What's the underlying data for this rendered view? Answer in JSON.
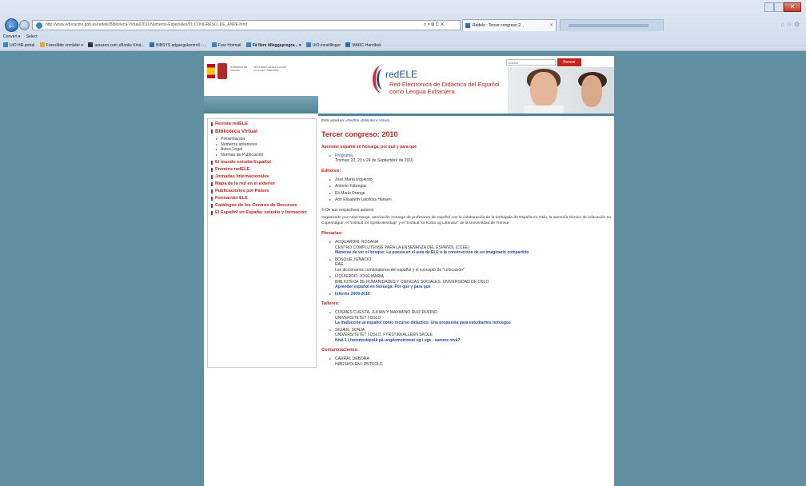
{
  "browser": {
    "address_url": "http://www.educacion.gob.es/redele/Biblioteca-Virtual/2011/Numeros-Especiales/III_CONGRESO_DE_ANPE.html",
    "address_tools": "⌕ ▾ ⊠ C ✕",
    "tab_title": "Redele : Tercer congreso 2...",
    "cmd_convert": "Convert ▾",
    "cmd_select": "Select",
    "favorites": [
      "UiO HR-portal",
      "Foreslåtte områder ▾",
      "amazon.com eBooks Kind...",
      "BIBSYS adgangskontroll - ...",
      "Free Hotmail",
      "Få flere tilleggsprogra... ▾",
      "UiO-innstillinger",
      "MARC-Handbok"
    ],
    "close_glyph": "✕",
    "toolbar_icons": "⌂ ☆ ⚙",
    "back_glyph": "←",
    "forward_glyph": "→"
  },
  "header": {
    "gobierno_text": "GOBIERNO DE ESPAÑA",
    "ministerio_text": "MINISTERIO DE EDUCACIÓN, CULTURA Y DEPORTE",
    "brand": "redELE",
    "tagline": "Red Electrónica de Didáctica del Español como Lengua Extranjera",
    "search_placeholder": "Buscar",
    "search_button": "Buscar"
  },
  "sidebar": {
    "items_top": [
      {
        "label": "Revista redELE"
      }
    ],
    "selected": {
      "label": "Biblioteca Virtual"
    },
    "subitems": [
      {
        "label": "Presentación"
      },
      {
        "label": "Números anteriores"
      },
      {
        "label": "Aviso-Legal"
      },
      {
        "label": "Normas de Publicación"
      }
    ],
    "items_bottom": [
      {
        "label": "El mundo estudia Español"
      },
      {
        "label": "Premios redELE"
      },
      {
        "label": "Jornadas Internacionales"
      },
      {
        "label": "Mapa de la red en el exterior"
      },
      {
        "label": "Publicaciones por Países"
      },
      {
        "label": "Formación ELE"
      },
      {
        "label": "Catálogos de los Centros de Recursos"
      },
      {
        "label": "El Español en España: estudio y formación"
      }
    ]
  },
  "main": {
    "crumbs_prefix": "Está usted en:",
    "crumb1": "RedEle",
    "crumb2": "Biblioteca Virtual",
    "title": "Tercer congreso: 2010",
    "subtitle": "Aprender español en Noruega, por qué y para qué",
    "programa_link": "Programa",
    "programa_place": "Tromsø, 22, 23 y 24 de Septiembre de 2010",
    "editores_heading": "Editores:",
    "editores": [
      "José María Izquierdo",
      "Antonio Fábregas",
      "Eli-Marie Drange",
      "Ann Elisabeth Laksfoss Hansen"
    ],
    "copyright": "© De sus respectivos autores",
    "para": "Organizado por Anpe-Norga, asociación noruega de profesores de español con la colaboración de la embajada de España en Oslo, la asesoría técnica de educación en Copenhague, el \"Institutt for Språkvitenskap\" y el \"Institutt for Kultur og Litteratur\" de la Universidad de Tromsø",
    "plenarias_heading": "Plenarias:",
    "plenarias": [
      {
        "name": "ACQUARONI, ROSANA",
        "inst": "CENTRO COMPLUTENSE PARA LA ENSEÑANZA DEL ESPAÑOL (CCEE)",
        "title": "Maneras de ver el bosque: La poesía en el aula de ELE o la construcción de un imaginario compartido",
        "title_link": true
      },
      {
        "name": "BOSQUE, IGNACIO",
        "inst": "RAE",
        "title": "Los diccionarios combinatorios del español y el concepto de \"colocación\"",
        "title_link": false
      },
      {
        "name": "IZQUIERDO, JOSÉ MARÍA",
        "inst": "BIBLIOTECA DE HUMANIDADES Y CIENCIAS SOCIALES. UNIVERSIDAD DE OSLO",
        "title": "Aprender español en Noruega: Por qué y para qué",
        "title_link": true
      }
    ],
    "informe": "Informe 2009-2010",
    "talleres_heading": "Talleres:",
    "talleres": [
      {
        "name": "COSMES CUESTA, JULIÁN Y MAXIMINO RUIZ RUFINO",
        "inst": "UNIVERSITETET I OSLO",
        "title": "La traducción al español como recurso didáctico: Una propuesta para estudiantes noruegos"
      },
      {
        "name": "SKJÆR, SONJA",
        "inst": "UNIVERSITETET I OSLO, FYRSTIKKALLEEN SKOLE",
        "title": "Nivå 1 i fremmedspråk på ungdomstrinnet og i vgs - samme nivå?"
      }
    ],
    "comunicaciones_heading": "Comunicaciones:",
    "comunicaciones": [
      {
        "name": "CARRAI, DEBORA",
        "inst": "HØGSKOLEN I ØSTFOLD"
      }
    ]
  }
}
